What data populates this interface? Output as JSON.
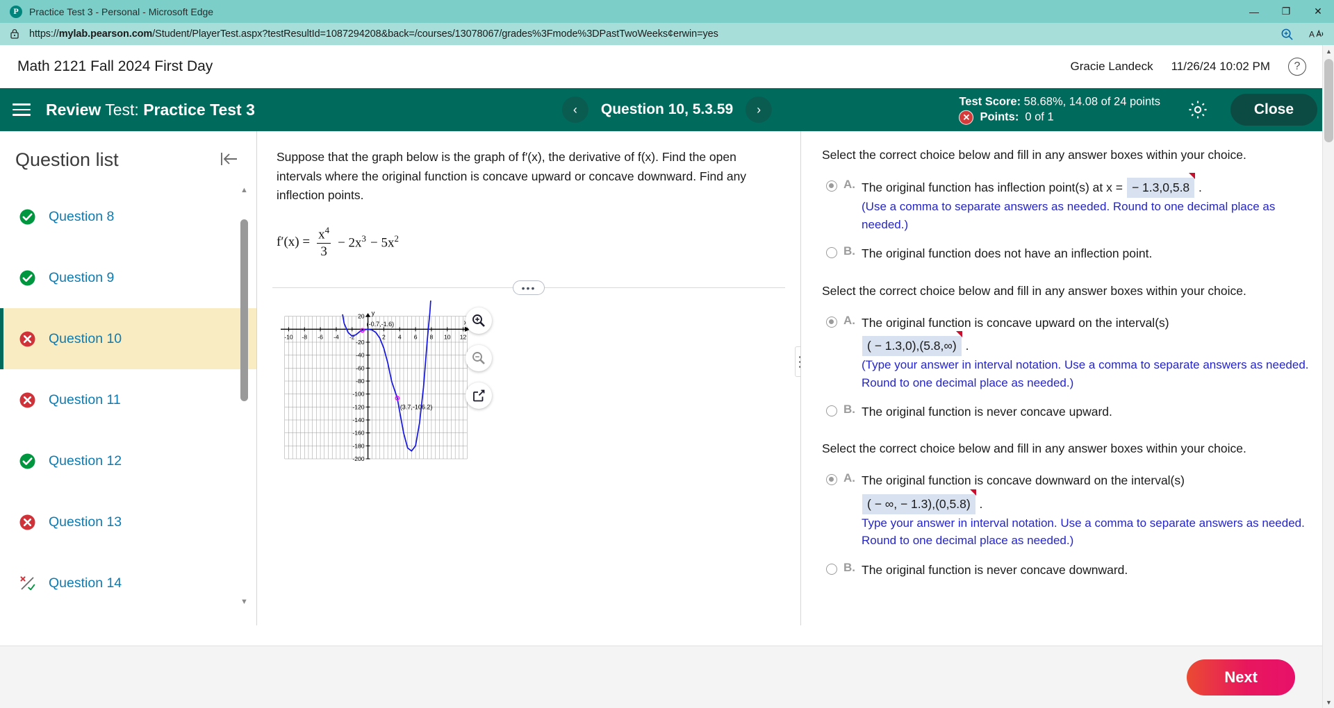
{
  "browser": {
    "tab_title": "Practice Test 3 - Personal - Microsoft Edge",
    "favicon_letter": "P",
    "url": "https://mylab.pearson.com/Student/PlayerTest.aspx?testResultId=1087294208&back=/courses/13078067/grades%3Fmode%3DPastTwoWeeks&centerwin=yes",
    "url_bold": "mylab.pearson.com",
    "minimize_label": "—",
    "maximize_label": "❐",
    "close_label": "✕",
    "zoom_icon": "zoom-in-icon",
    "read_aloud_icon": "read-aloud-icon"
  },
  "header": {
    "course_title": "Math 2121 Fall 2024 First Day",
    "user_name": "Gracie Landeck",
    "datetime": "11/26/24 10:02 PM",
    "help_label": "?"
  },
  "toolbar": {
    "menu_icon": "hamburger-menu-icon",
    "review_word": "Review",
    "test_word": "Test:",
    "test_name": "Practice Test 3",
    "prev_label": "‹",
    "next_label": "›",
    "question_title": "Question 10, 5.3.59",
    "score_label": "Test Score:",
    "score_value": "58.68%, 14.08 of 24 points",
    "points_label": "Points:",
    "points_value": "0 of 1",
    "points_status_icon": "error-x-icon",
    "settings_icon": "gear-icon",
    "close_label": "Close"
  },
  "question_list": {
    "title": "Question list",
    "collapse_icon": "collapse-panel-icon",
    "items": [
      {
        "label": "Question 8",
        "status": "correct",
        "active": false
      },
      {
        "label": "Question 9",
        "status": "correct",
        "active": false
      },
      {
        "label": "Question 10",
        "status": "incorrect",
        "active": true
      },
      {
        "label": "Question 11",
        "status": "incorrect",
        "active": false
      },
      {
        "label": "Question 12",
        "status": "correct",
        "active": false
      },
      {
        "label": "Question 13",
        "status": "incorrect",
        "active": false
      },
      {
        "label": "Question 14",
        "status": "partial",
        "active": false
      }
    ]
  },
  "question": {
    "text": "Suppose that the graph below is the graph of f′(x), the derivative of f(x). Find the open intervals where the original function is concave upward or concave downward. Find any inflection points.",
    "formula": {
      "lhs": "f′(x) =",
      "numerator": "x",
      "numerator_exp": "4",
      "denominator": "3",
      "term2": "− 2x",
      "term2_exp": "3",
      "term3": "− 5x",
      "term3_exp": "2"
    },
    "expand_dots": "•••",
    "tools": {
      "zoom_in": "zoom-in-icon",
      "zoom_out": "zoom-out-icon",
      "open_external": "open-in-new-window-icon"
    }
  },
  "chart_data": {
    "type": "line",
    "title": "",
    "xlabel": "x",
    "ylabel": "y",
    "xlim": [
      -11,
      13
    ],
    "ylim": [
      -200,
      25
    ],
    "x_ticks": [
      -10,
      -8,
      -6,
      -4,
      -2,
      2,
      4,
      6,
      8,
      10,
      12
    ],
    "y_ticks": [
      20,
      -20,
      -40,
      -60,
      -80,
      -100,
      -120,
      -140,
      -160,
      -180,
      -200
    ],
    "grid": true,
    "series": [
      {
        "name": "f'(x) = x^4/3 - 2x^3 - 5x^2",
        "color": "#1414e0",
        "x": [
          -3.2,
          -3.0,
          -2.5,
          -2.0,
          -1.5,
          -1.0,
          -0.7,
          -0.5,
          0,
          0.5,
          1,
          1.5,
          2,
          2.5,
          3,
          3.7,
          4,
          4.5,
          5,
          5.5,
          6,
          6.5,
          7,
          7.5,
          7.8,
          8.0
        ],
        "y": [
          23.0,
          9.0,
          -5.0,
          -10.7,
          -8.4,
          -3.3,
          -1.6,
          -1.0,
          0,
          -1.0,
          -5.0,
          -13.9,
          -29.3,
          -52.1,
          -81.0,
          -106.2,
          -127.0,
          -160.3,
          -183.3,
          -187.9,
          -180.0,
          -145.0,
          -90.0,
          -14.0,
          25.0,
          60.0
        ]
      }
    ],
    "annotations": [
      {
        "label": "(-0.7,-1.6)",
        "x": -0.7,
        "y": -1.6,
        "point_color": "#ff00ff"
      },
      {
        "label": "(3.7,-106.2)",
        "x": 3.7,
        "y": -106.2,
        "point_color": "#ff00ff"
      }
    ]
  },
  "answers": {
    "groups": [
      {
        "prompt": "Select the correct choice below and fill in any answer boxes within your choice.",
        "choices": [
          {
            "letter": "A.",
            "selected": true,
            "text_before": "The original function has inflection point(s) at x =",
            "answer_value": "− 1.3,0,5.8",
            "text_after": ".",
            "hint": "(Use a comma to separate answers as needed. Round to one decimal place as needed.)",
            "layout": "inline"
          },
          {
            "letter": "B.",
            "selected": false,
            "text_before": "The original function does not have an inflection point.",
            "answer_value": "",
            "text_after": "",
            "hint": "",
            "layout": "plain"
          }
        ]
      },
      {
        "prompt": "Select the correct choice below and fill in any answer boxes within your choice.",
        "choices": [
          {
            "letter": "A.",
            "selected": true,
            "text_before": "The original function is concave upward on the interval(s)",
            "answer_value": "( − 1.3,0),(5.8,∞)",
            "text_after": ".",
            "hint": "(Type your answer in interval notation. Use a comma to separate answers as needed. Round to one decimal place as needed.)",
            "layout": "block"
          },
          {
            "letter": "B.",
            "selected": false,
            "text_before": "The original function is never concave upward.",
            "answer_value": "",
            "text_after": "",
            "hint": "",
            "layout": "plain"
          }
        ]
      },
      {
        "prompt": "Select the correct choice below and fill in any answer boxes within your choice.",
        "choices": [
          {
            "letter": "A.",
            "selected": true,
            "text_before": "The original function is concave downward on the interval(s)",
            "answer_value": "( − ∞, − 1.3),(0,5.8)",
            "text_after": ".",
            "hint": "Type your answer in interval notation. Use a comma to separate answers as needed. Round to one decimal place as needed.)",
            "layout": "block"
          },
          {
            "letter": "B.",
            "selected": false,
            "text_before": "The original function is never concave downward.",
            "answer_value": "",
            "text_after": "",
            "hint": "",
            "layout": "plain"
          }
        ]
      }
    ]
  },
  "footer": {
    "next_label": "Next"
  }
}
